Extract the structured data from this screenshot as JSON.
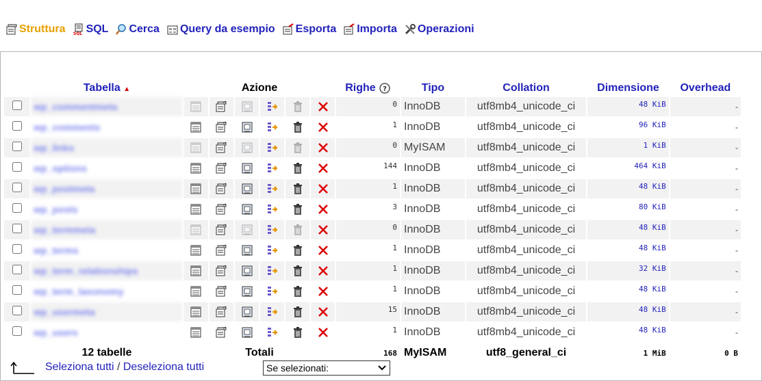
{
  "tabs": [
    {
      "label": "Struttura",
      "icon": "structure-icon",
      "active": true
    },
    {
      "label": "SQL",
      "icon": "sql-icon",
      "active": false
    },
    {
      "label": "Cerca",
      "icon": "search-icon",
      "active": false
    },
    {
      "label": "Query da esempio",
      "icon": "query-icon",
      "active": false
    },
    {
      "label": "Esporta",
      "icon": "export-icon",
      "active": false
    },
    {
      "label": "Importa",
      "icon": "import-icon",
      "active": false
    },
    {
      "label": "Operazioni",
      "icon": "operations-icon",
      "active": false
    }
  ],
  "table": {
    "headers": {
      "tabella": "Tabella",
      "azione": "Azione",
      "righe": "Righe",
      "tipo": "Tipo",
      "collation": "Collation",
      "dimensione": "Dimensione",
      "overhead": "Overhead"
    },
    "rows": [
      {
        "name": "wp_commentmeta",
        "righe": "0",
        "tipo": "InnoDB",
        "collation": "utf8mb4_unicode_ci",
        "dimensione": "48 KiB",
        "overhead": "-",
        "empty": true
      },
      {
        "name": "wp_comments",
        "righe": "1",
        "tipo": "InnoDB",
        "collation": "utf8mb4_unicode_ci",
        "dimensione": "96 KiB",
        "overhead": "-",
        "empty": false
      },
      {
        "name": "wp_links",
        "righe": "0",
        "tipo": "MyISAM",
        "collation": "utf8mb4_unicode_ci",
        "dimensione": "1 KiB",
        "overhead": "-",
        "empty": true
      },
      {
        "name": "wp_options",
        "righe": "144",
        "tipo": "InnoDB",
        "collation": "utf8mb4_unicode_ci",
        "dimensione": "464 KiB",
        "overhead": "-",
        "empty": false
      },
      {
        "name": "wp_postmeta",
        "righe": "1",
        "tipo": "InnoDB",
        "collation": "utf8mb4_unicode_ci",
        "dimensione": "48 KiB",
        "overhead": "-",
        "empty": false
      },
      {
        "name": "wp_posts",
        "righe": "3",
        "tipo": "InnoDB",
        "collation": "utf8mb4_unicode_ci",
        "dimensione": "80 KiB",
        "overhead": "-",
        "empty": false
      },
      {
        "name": "wp_termmeta",
        "righe": "0",
        "tipo": "InnoDB",
        "collation": "utf8mb4_unicode_ci",
        "dimensione": "48 KiB",
        "overhead": "-",
        "empty": true
      },
      {
        "name": "wp_terms",
        "righe": "1",
        "tipo": "InnoDB",
        "collation": "utf8mb4_unicode_ci",
        "dimensione": "48 KiB",
        "overhead": "-",
        "empty": false
      },
      {
        "name": "wp_term_relationships",
        "righe": "1",
        "tipo": "InnoDB",
        "collation": "utf8mb4_unicode_ci",
        "dimensione": "32 KiB",
        "overhead": "-",
        "empty": false
      },
      {
        "name": "wp_term_taxonomy",
        "righe": "1",
        "tipo": "InnoDB",
        "collation": "utf8mb4_unicode_ci",
        "dimensione": "48 KiB",
        "overhead": "-",
        "empty": false
      },
      {
        "name": "wp_usermeta",
        "righe": "15",
        "tipo": "InnoDB",
        "collation": "utf8mb4_unicode_ci",
        "dimensione": "48 KiB",
        "overhead": "-",
        "empty": false
      },
      {
        "name": "wp_users",
        "righe": "1",
        "tipo": "InnoDB",
        "collation": "utf8mb4_unicode_ci",
        "dimensione": "48 KiB",
        "overhead": "-",
        "empty": false
      }
    ],
    "totals": {
      "count_label": "12 tabelle",
      "label": "Totali",
      "righe": "168",
      "tipo": "MyISAM",
      "collation": "utf8_general_ci",
      "dimensione": "1 MiB",
      "overhead": "0 B"
    }
  },
  "footer": {
    "select_all": "Seleziona tutti",
    "separator": " / ",
    "deselect_all": "Deseleziona tutti",
    "with_selected": "Se selezionati:"
  },
  "colors": {
    "link": "#2222bb",
    "active_tab": "#e8a000",
    "drop_red": "#dd0000"
  }
}
